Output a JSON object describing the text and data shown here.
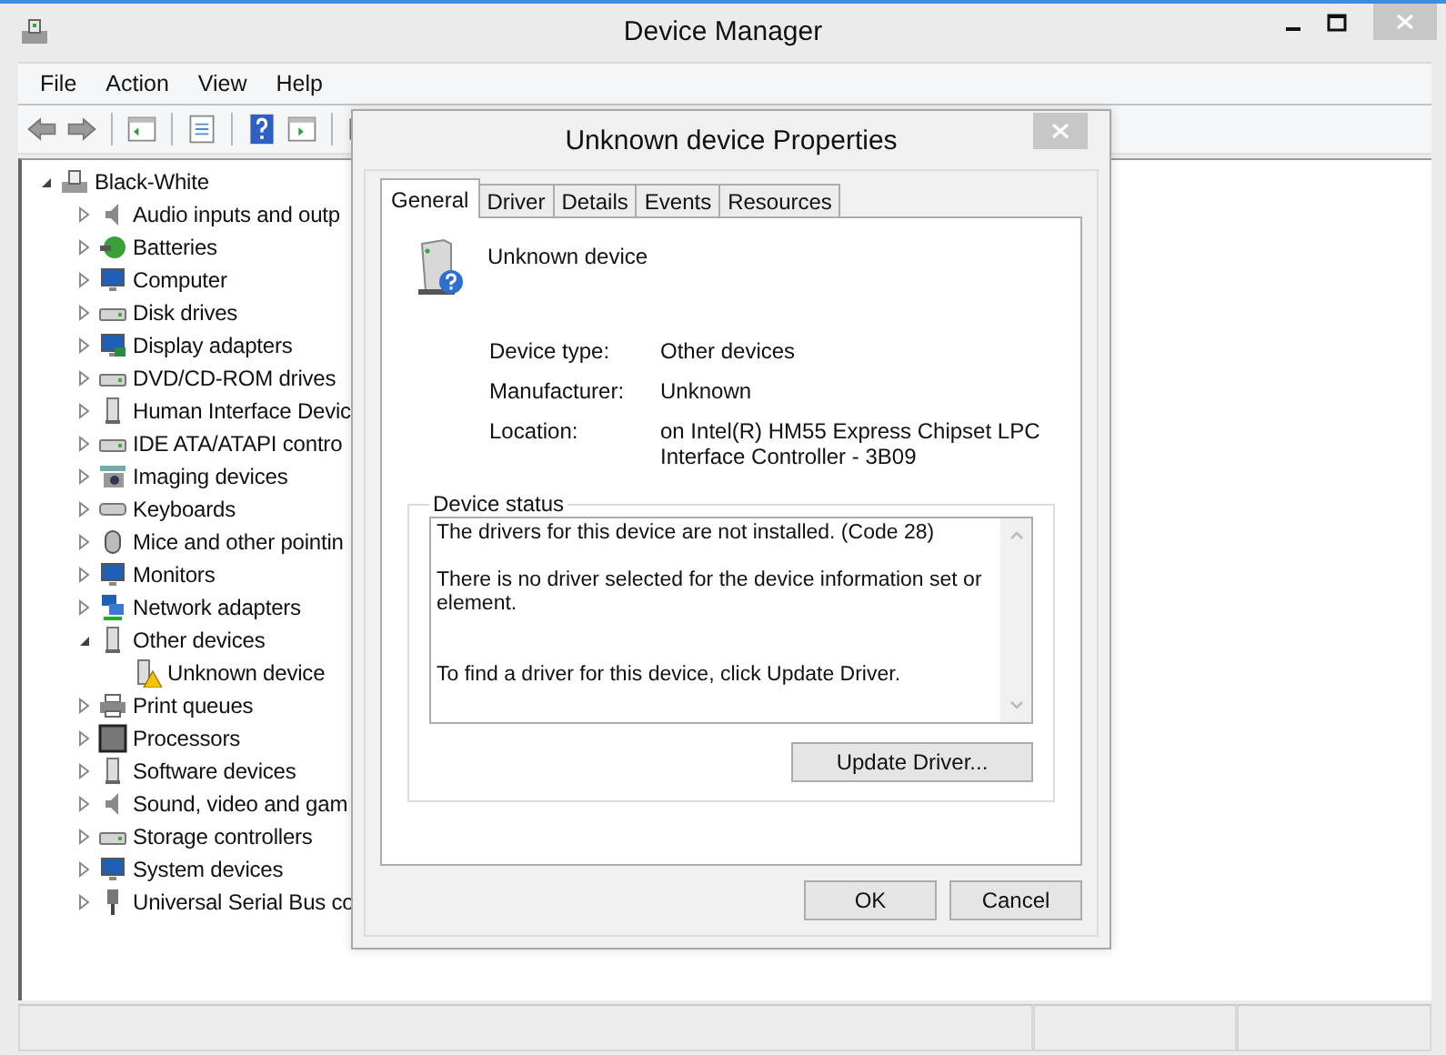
{
  "window": {
    "title": "Device Manager"
  },
  "menu": [
    "File",
    "Action",
    "View",
    "Help"
  ],
  "tree": {
    "label": "Black-White",
    "expanded": true,
    "children": [
      {
        "label": "Audio inputs and outp",
        "expanded": false
      },
      {
        "label": "Batteries",
        "expanded": false
      },
      {
        "label": "Computer",
        "expanded": false
      },
      {
        "label": "Disk drives",
        "expanded": false
      },
      {
        "label": "Display adapters",
        "expanded": false
      },
      {
        "label": "DVD/CD-ROM drives",
        "expanded": false
      },
      {
        "label": "Human Interface Devic",
        "expanded": false
      },
      {
        "label": "IDE ATA/ATAPI contro",
        "expanded": false
      },
      {
        "label": "Imaging devices",
        "expanded": false
      },
      {
        "label": "Keyboards",
        "expanded": false
      },
      {
        "label": "Mice and other pointin",
        "expanded": false
      },
      {
        "label": "Monitors",
        "expanded": false
      },
      {
        "label": "Network adapters",
        "expanded": false
      },
      {
        "label": "Other devices",
        "expanded": true,
        "children": [
          {
            "label": "Unknown device",
            "problem": true
          }
        ]
      },
      {
        "label": "Print queues",
        "expanded": false
      },
      {
        "label": "Processors",
        "expanded": false
      },
      {
        "label": "Software devices",
        "expanded": false
      },
      {
        "label": "Sound, video and gam",
        "expanded": false
      },
      {
        "label": "Storage controllers",
        "expanded": false
      },
      {
        "label": "System devices",
        "expanded": false
      },
      {
        "label": "Universal Serial Bus co",
        "expanded": false
      }
    ]
  },
  "dialog": {
    "title": "Unknown device Properties",
    "tabs": [
      {
        "label": "General",
        "selected": true
      },
      {
        "label": "Driver",
        "selected": false
      },
      {
        "label": "Details",
        "selected": false
      },
      {
        "label": "Events",
        "selected": false
      },
      {
        "label": "Resources",
        "selected": false
      }
    ],
    "device_name": "Unknown device",
    "properties": [
      {
        "label": "Device type:",
        "value": "Other devices"
      },
      {
        "label": "Manufacturer:",
        "value": "Unknown"
      },
      {
        "label": "Location:",
        "value": "on Intel(R) HM55 Express Chipset LPC Interface Controller - 3B09"
      }
    ],
    "status_group": {
      "title": "Device status",
      "paragraphs": [
        "The drivers for this device are not installed. (Code 28)",
        "There is no driver selected for the device information set or element.",
        "To find a driver for this device, click Update Driver."
      ]
    },
    "update_button": "Update Driver...",
    "buttons": [
      "OK",
      "Cancel"
    ]
  }
}
